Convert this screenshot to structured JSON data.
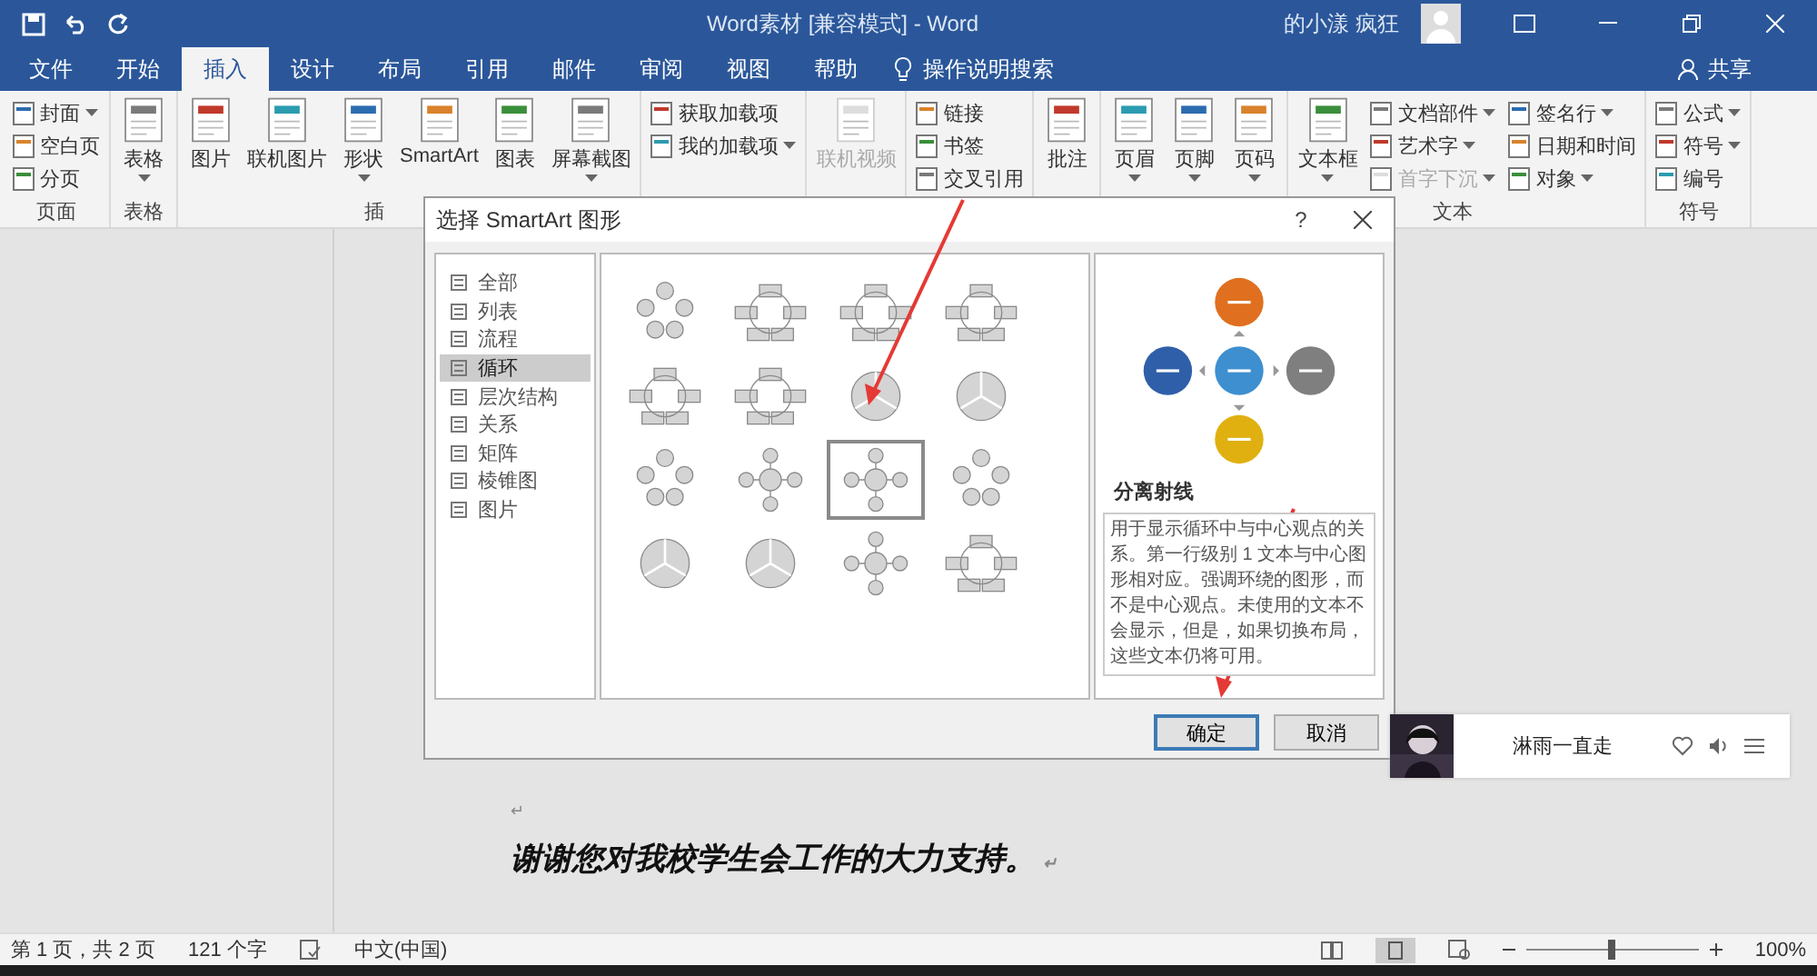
{
  "window": {
    "title": "Word素材 [兼容模式] - Word",
    "user": "的小漾 疯狂"
  },
  "tabs": [
    {
      "label": "文件",
      "selected": false
    },
    {
      "label": "开始",
      "selected": false
    },
    {
      "label": "插入",
      "selected": true
    },
    {
      "label": "设计",
      "selected": false
    },
    {
      "label": "布局",
      "selected": false
    },
    {
      "label": "引用",
      "selected": false
    },
    {
      "label": "邮件",
      "selected": false
    },
    {
      "label": "审阅",
      "selected": false
    },
    {
      "label": "视图",
      "selected": false
    },
    {
      "label": "帮助",
      "selected": false
    }
  ],
  "tell_me": "操作说明搜索",
  "share": "共享",
  "ribbon": [
    {
      "label": "页面",
      "items": [
        {
          "kind": "small",
          "label": "封面",
          "dropdown": true,
          "disabled": false
        },
        {
          "kind": "small",
          "label": "空白页",
          "dropdown": false,
          "disabled": false
        },
        {
          "kind": "small",
          "label": "分页",
          "dropdown": false,
          "disabled": false
        }
      ]
    },
    {
      "label": "表格",
      "items": [
        {
          "kind": "large",
          "label": "表格",
          "dropdown": true,
          "disabled": false
        }
      ]
    },
    {
      "label": "插",
      "items": [
        {
          "kind": "large",
          "label": "图片",
          "dropdown": false,
          "disabled": false
        },
        {
          "kind": "large",
          "label": "联机图片",
          "dropdown": false,
          "disabled": false
        },
        {
          "kind": "large",
          "label": "形状",
          "dropdown": true,
          "disabled": false
        },
        {
          "kind": "large",
          "label": "SmartArt",
          "dropdown": false,
          "disabled": false
        },
        {
          "kind": "large",
          "label": "图表",
          "dropdown": false,
          "disabled": false
        },
        {
          "kind": "large",
          "label": "屏幕截图",
          "dropdown": true,
          "disabled": false
        }
      ]
    },
    {
      "items": [
        {
          "kind": "small",
          "label": "获取加载项",
          "dropdown": false,
          "disabled": false
        },
        {
          "kind": "small",
          "label": "我的加载项",
          "dropdown": true,
          "disabled": false
        }
      ]
    },
    {
      "items": [
        {
          "kind": "large",
          "label": "联机视频",
          "dropdown": false,
          "disabled": true
        }
      ]
    },
    {
      "items": [
        {
          "kind": "small",
          "label": "链接",
          "dropdown": false,
          "disabled": false
        },
        {
          "kind": "small",
          "label": "书签",
          "dropdown": false,
          "disabled": false
        },
        {
          "kind": "small",
          "label": "交叉引用",
          "dropdown": false,
          "disabled": false
        }
      ]
    },
    {
      "items": [
        {
          "kind": "large",
          "label": "批注",
          "dropdown": false,
          "disabled": false
        }
      ]
    },
    {
      "items": [
        {
          "kind": "large",
          "label": "页眉",
          "dropdown": true,
          "disabled": false
        },
        {
          "kind": "large",
          "label": "页脚",
          "dropdown": true,
          "disabled": false
        },
        {
          "kind": "large",
          "label": "页码",
          "dropdown": true,
          "disabled": false
        }
      ]
    },
    {
      "label": "文本",
      "items": [
        {
          "kind": "large",
          "label": "文本框",
          "dropdown": true,
          "disabled": false
        },
        {
          "kind": "small",
          "label": "文档部件",
          "dropdown": true,
          "disabled": false
        },
        {
          "kind": "small",
          "label": "艺术字",
          "dropdown": true,
          "disabled": false
        },
        {
          "kind": "small",
          "label": "首字下沉",
          "dropdown": true,
          "disabled": true
        },
        {
          "kind": "small",
          "label": "签名行",
          "dropdown": true,
          "disabled": false
        },
        {
          "kind": "small",
          "label": "日期和时间",
          "dropdown": false,
          "disabled": false
        },
        {
          "kind": "small",
          "label": "对象",
          "dropdown": true,
          "disabled": false
        }
      ]
    },
    {
      "label": "符号",
      "items": [
        {
          "kind": "small",
          "label": "公式",
          "dropdown": true,
          "disabled": false
        },
        {
          "kind": "small",
          "label": "符号",
          "dropdown": true,
          "disabled": false
        },
        {
          "kind": "small",
          "label": "编号",
          "dropdown": false,
          "disabled": false
        }
      ]
    }
  ],
  "dialog": {
    "title": "选择 SmartArt 图形",
    "help": "?",
    "categories": [
      {
        "label": "全部",
        "selected": false
      },
      {
        "label": "列表",
        "selected": false
      },
      {
        "label": "流程",
        "selected": false
      },
      {
        "label": "循环",
        "selected": true
      },
      {
        "label": "层次结构",
        "selected": false
      },
      {
        "label": "关系",
        "selected": false
      },
      {
        "label": "矩阵",
        "selected": false
      },
      {
        "label": "棱锥图",
        "selected": false
      },
      {
        "label": "图片",
        "selected": false
      }
    ],
    "layouts": [
      {
        "selected": false
      },
      {
        "selected": false
      },
      {
        "selected": false
      },
      {
        "selected": false
      },
      {
        "selected": false
      },
      {
        "selected": false
      },
      {
        "selected": false
      },
      {
        "selected": false
      },
      {
        "selected": false
      },
      {
        "selected": false
      },
      {
        "selected": true
      },
      {
        "selected": false
      },
      {
        "selected": false
      },
      {
        "selected": false
      },
      {
        "selected": false
      },
      {
        "selected": false
      }
    ],
    "preview_title": "分离射线",
    "description": "用于显示循环中与中心观点的关系。第一行级别 1 文本与中心图形相对应。强调环绕的图形，而不是中心观点。未使用的文本不会显示，但是，如果切换布局，这些文本仍将可用。",
    "buttons": [
      {
        "label": "确定",
        "default": true
      },
      {
        "label": "取消",
        "default": false
      }
    ]
  },
  "document": {
    "mark": "↵",
    "text": "谢谢您对我校学生会工作的大力支持。"
  },
  "player": {
    "song": "淋雨一直走"
  },
  "status_bar": {
    "page": "第 1 页，共 2 页",
    "words": "121 个字",
    "language": "中文(中国)",
    "zoom": "100%",
    "zoom_slider": {
      "level": 0.5
    }
  }
}
